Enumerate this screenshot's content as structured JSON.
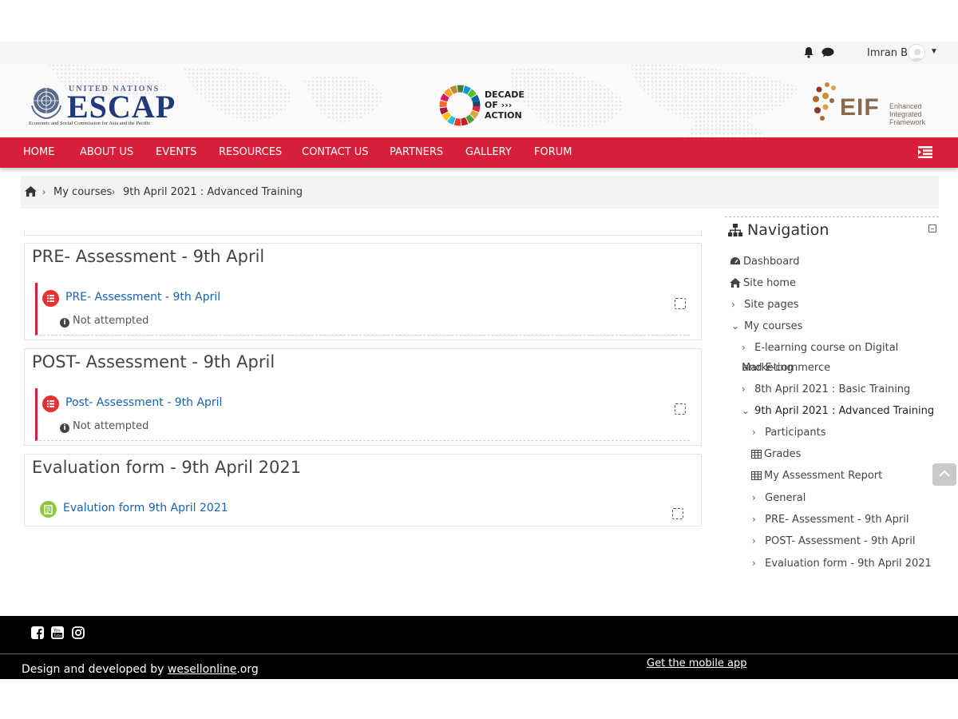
{
  "header": {
    "user_name": "Imran B",
    "icons": [
      "bell-icon",
      "chat-icon",
      "avatar",
      "caret-down-icon"
    ]
  },
  "logos": {
    "escap_top": "UNITED NATIONS",
    "escap_main": "ESCAP",
    "escap_sub": "Economic and Social Commission for Asia and the Pacific",
    "decade_text": "DECADE\nOF ›››\nACTION",
    "eif_main": "EIF",
    "eif_sub": "Enhanced\nIntegrated\nFramework"
  },
  "main_nav": {
    "items": [
      "HOME",
      "ABOUT US",
      "EVENTS",
      "RESOURCES",
      "CONTACT US",
      "PARTNERS",
      "GALLERY",
      "FORUM"
    ],
    "accent": "#d71f3a"
  },
  "breadcrumb": {
    "items": [
      "My courses",
      "9th April 2021 : Advanced Training"
    ]
  },
  "sections": [
    {
      "title": "PRE- Assessment - 9th April",
      "activity": {
        "label": "PRE- Assessment - 9th April",
        "status": "Not attempted",
        "icon": "quiz-icon",
        "icon_color": "#e8312f"
      }
    },
    {
      "title": "POST- Assessment - 9th April",
      "activity": {
        "label": "Post- Assessment - 9th April",
        "status": "Not attempted",
        "icon": "quiz-icon",
        "icon_color": "#e8312f"
      }
    },
    {
      "title": "Evaluation form - 9th April 2021",
      "activity": {
        "label": "Evalution form 9th April 2021",
        "icon": "feedback-icon",
        "icon_color": "#8dc63f"
      }
    }
  ],
  "navigation": {
    "title": "Navigation",
    "items": [
      {
        "label": "Dashboard",
        "icon": "dashboard-icon"
      },
      {
        "label": "Site home",
        "icon": "home-icon"
      },
      {
        "label": "Site pages",
        "icon": "chevron-right-icon"
      },
      {
        "label": "My courses",
        "icon": "chevron-down-icon"
      },
      {
        "label": "E-learning course on Digital Marketing",
        "label2": "and E-commerce",
        "icon": "chevron-right-icon"
      },
      {
        "label": "8th April 2021 : Basic Training",
        "icon": "chevron-right-icon"
      },
      {
        "label": "9th April 2021 : Advanced Training",
        "icon": "chevron-down-icon"
      },
      {
        "label": "Participants",
        "icon": "chevron-right-icon"
      },
      {
        "label": "Grades",
        "icon": "table-icon"
      },
      {
        "label": "My Assessment Report",
        "icon": "table-icon"
      },
      {
        "label": "General",
        "icon": "chevron-right-icon"
      },
      {
        "label": "PRE- Assessment - 9th April",
        "icon": "chevron-right-icon"
      },
      {
        "label": "POST- Assessment - 9th April",
        "icon": "chevron-right-icon"
      },
      {
        "label": "Evaluation form - 9th April 2021",
        "icon": "chevron-right-icon"
      }
    ]
  },
  "footer": {
    "credit_prefix": "Design and developed by ",
    "credit_link": "wesellonline",
    "credit_suffix": ".org",
    "mobile_app": "Get the mobile app",
    "social_icons": [
      "facebook-icon",
      "youtube-icon",
      "instagram-icon"
    ]
  }
}
